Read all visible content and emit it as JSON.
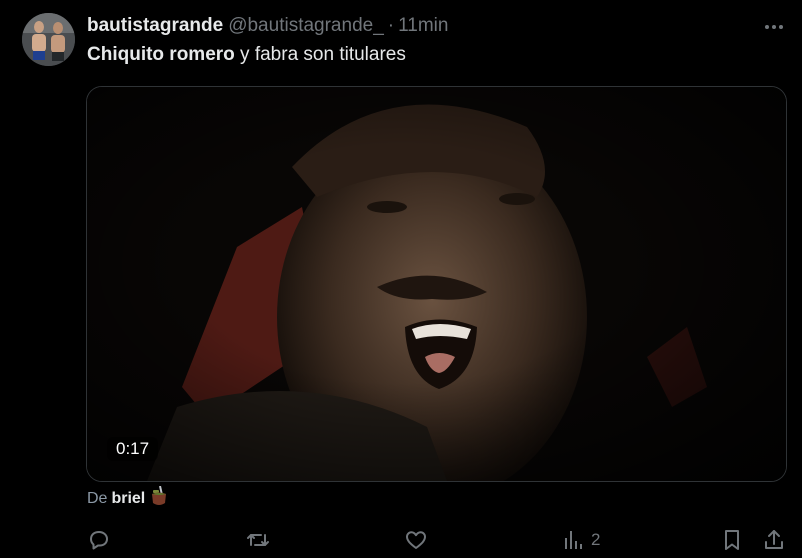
{
  "tweet": {
    "display_name": "bautistagrande",
    "handle": "@bautistagrande_",
    "separator": "·",
    "time": "11min",
    "text_bold": "Chiquito romero",
    "text_rest": " y fabra son titulares",
    "video_duration": "0:17"
  },
  "attribution": {
    "prefix": "De",
    "user": "briel",
    "emoji_icon": "mate-icon"
  },
  "actions": {
    "reply_icon": "reply-icon",
    "retweet_icon": "retweet-icon",
    "like_icon": "heart-icon",
    "views_icon": "views-icon",
    "views_count": "2",
    "bookmark_icon": "bookmark-icon",
    "share_icon": "share-icon"
  },
  "colors": {
    "background": "#000000",
    "primary_text": "#e7e9ea",
    "secondary_text": "#71767b",
    "border": "#2f3336"
  }
}
